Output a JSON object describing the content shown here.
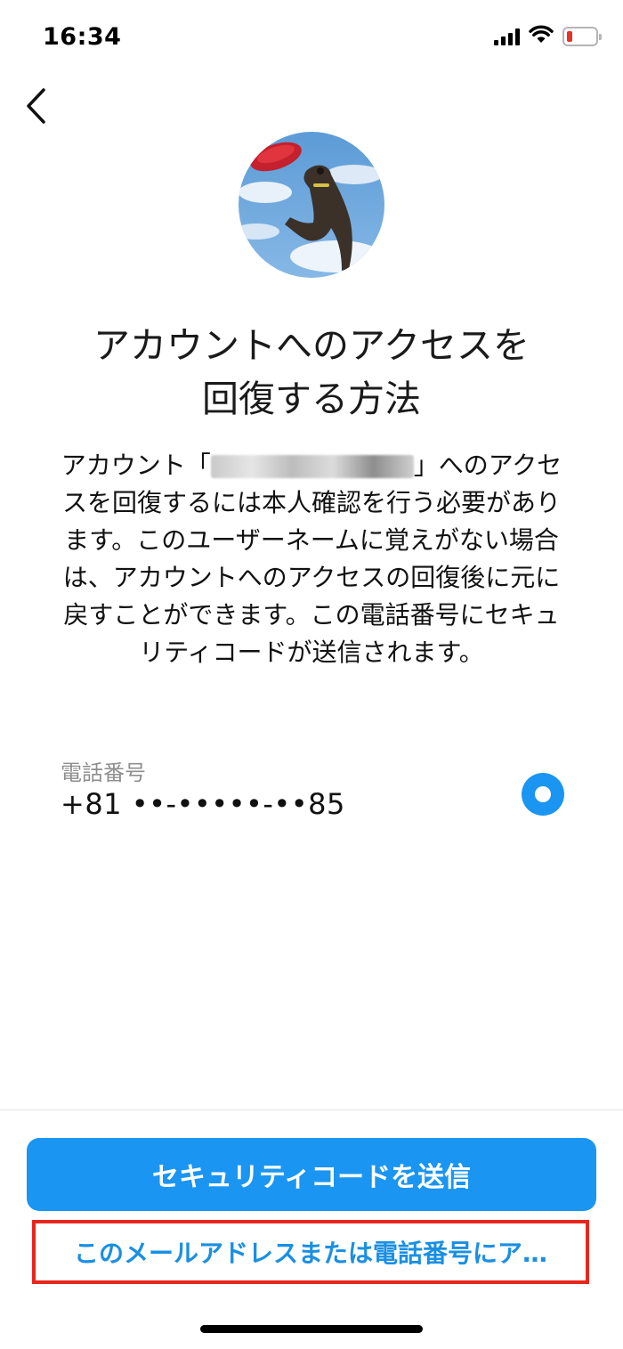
{
  "status_bar": {
    "time": "16:34",
    "signal_icon": "cellular-signal-icon",
    "wifi_icon": "wifi-icon",
    "battery_icon": "battery-low-icon",
    "battery_color": "#e5332a"
  },
  "nav": {
    "back_icon": "chevron-left-icon"
  },
  "profile": {
    "avatar": "profile-photo-dog-jumping-frisbee"
  },
  "title": {
    "line1": "アカウントへのアクセスを",
    "line2": "回復する方法"
  },
  "description": {
    "prefix": "アカウント「",
    "suffix": "」へのアクセスを回復するには本人確認を行う必要があります。このユーザーネームに覚えがない場合は、アカウントへのアクセスの回復後に元に戻すことができます。この電話番号にセキュリティコードが送信されます。"
  },
  "phone_option": {
    "label": "電話番号",
    "value": "+81 ••-•••••-••85",
    "selected": true
  },
  "actions": {
    "send_code_label": "セキュリティコードを送信",
    "alt_link_label": "このメールアドレスまたは電話番号にア…"
  },
  "colors": {
    "primary": "#1a95f1",
    "link": "#1a8fe3",
    "highlight_border": "#e8261d"
  }
}
